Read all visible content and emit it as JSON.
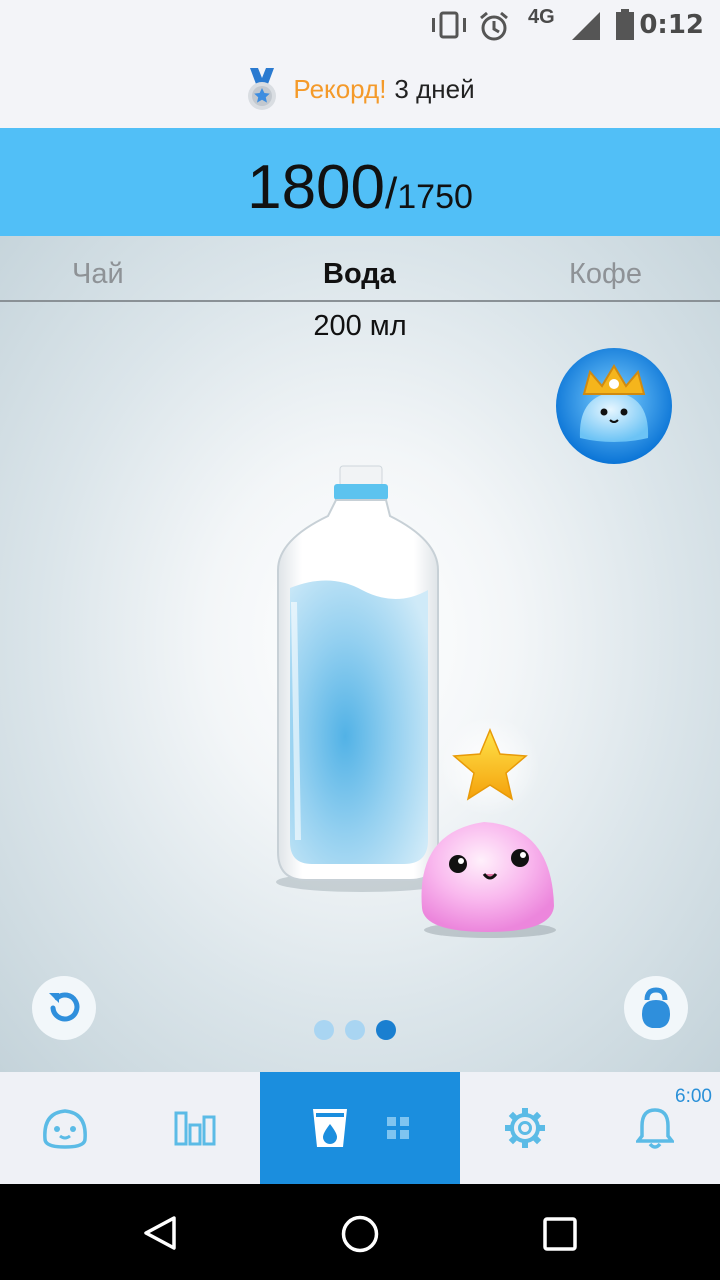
{
  "status_bar": {
    "network": "4G",
    "time": "0:12",
    "icons": [
      "vibrate-icon",
      "alarm-clock-icon",
      "signal-icon",
      "battery-icon"
    ]
  },
  "record_banner": {
    "icon": "medal-icon",
    "label": "Рекорд!",
    "value": "3 дней"
  },
  "progress": {
    "current": "1800",
    "separator": "/",
    "goal": "1750"
  },
  "drink_tabs": [
    {
      "label": "Чай",
      "active": false
    },
    {
      "label": "Вода",
      "active": true
    },
    {
      "label": "Кофе",
      "active": false
    }
  ],
  "volume": "200 мл",
  "bottle_fill_fraction": 0.85,
  "page_indicator": {
    "total": 3,
    "active": 3
  },
  "buttons": {
    "undo_icon": "undo-icon",
    "weight_icon": "kettlebell-icon"
  },
  "bottom_nav": {
    "items": [
      {
        "icon": "smiley-icon",
        "active": false
      },
      {
        "icon": "bar-chart-icon",
        "active": false
      },
      {
        "icon": "glass-icon",
        "active": true
      },
      {
        "icon": "gear-icon",
        "active": false
      },
      {
        "icon": "bell-icon",
        "active": false
      }
    ],
    "alarm_time": "6:00"
  },
  "colors": {
    "accent": "#51bff7",
    "nav_active": "#1b8ede",
    "record_orange": "#f49a2a",
    "icon_blue": "#5bbbe6"
  }
}
